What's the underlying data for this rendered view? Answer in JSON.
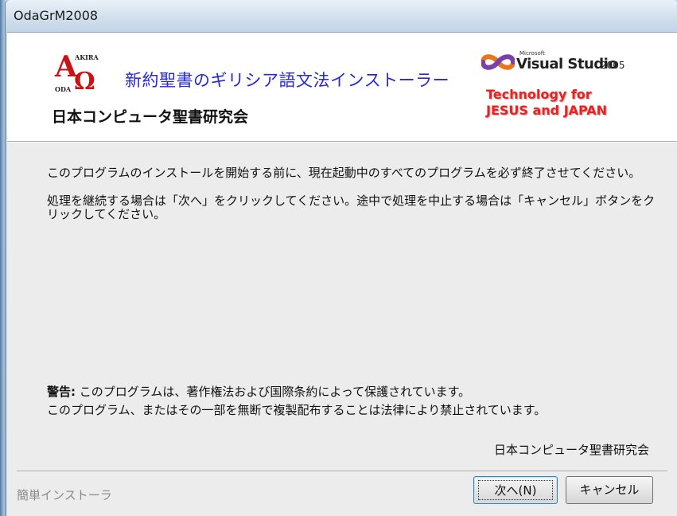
{
  "window": {
    "title": "OdaGrM2008"
  },
  "banner": {
    "logo_letter_a": "A",
    "logo_omega": "Ω",
    "logo_akira": "AKIRA",
    "logo_oda": "ODA",
    "title": "新約聖書のギリシア語文法インストーラー",
    "organization": "日本コンピュータ聖書研究会",
    "vs_brand_small": "Microsoft",
    "vs_name": "Visual Studio",
    "vs_year": "2005",
    "tagline_line1": "Technology for",
    "tagline_line2": "JESUS and JAPAN"
  },
  "message": {
    "paragraph1": "このプログラムのインストールを開始する前に、現在起動中のすべてのプログラムを必ず終了させてください。",
    "paragraph2": "処理を継続する場合は「次へ」をクリックしてください。途中で処理を中止する場合は「キャンセル」ボタンをクリックしてください。"
  },
  "warning": {
    "label": "警告:",
    "line1": " このプログラムは、著作権法および国際条約によって保護されています。",
    "line2": "このプログラム、またはその一部を無断で複製配布することは法律により禁止されています。"
  },
  "signature": "日本コンピュータ聖書研究会",
  "footer": {
    "brand": "簡単インストーラ",
    "next_label": "次へ(N)",
    "cancel_label": "キャンセル"
  },
  "colors": {
    "title_blue": "#2727d8",
    "tagline_red": "#ee2020",
    "logo_red": "#c81414"
  }
}
